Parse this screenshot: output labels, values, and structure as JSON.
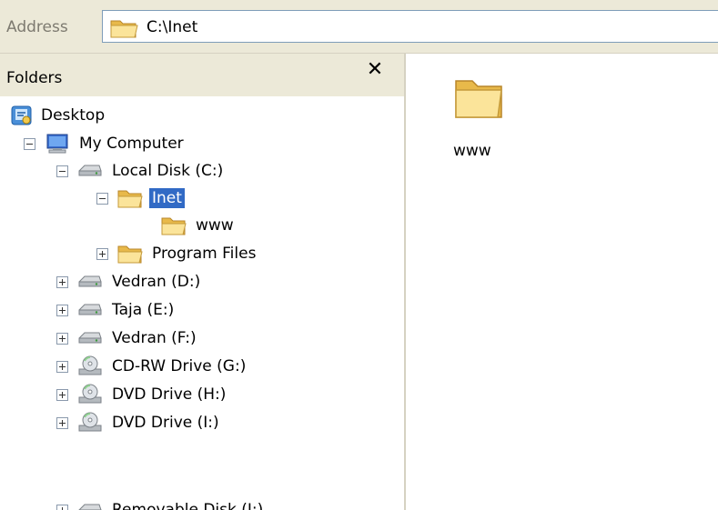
{
  "address": {
    "label": "Address",
    "value": "C:\\Inet"
  },
  "folders_pane": {
    "title": "Folders",
    "close_glyph": "✕",
    "items": [
      {
        "label": "Desktop",
        "icon": "desktop-icon"
      },
      {
        "label": "My Computer",
        "icon": "computer-icon",
        "expander": "minus"
      },
      {
        "label": "Local Disk (C:)",
        "icon": "hard-disk-icon",
        "expander": "minus"
      },
      {
        "label": "Inet",
        "icon": "folder-open-icon",
        "expander": "minus",
        "selected": true
      },
      {
        "label": "www",
        "icon": "folder-icon"
      },
      {
        "label": "Program Files",
        "icon": "folder-icon",
        "expander": "plus"
      },
      {
        "label": "Vedran (D:)",
        "icon": "hard-disk-icon",
        "expander": "plus"
      },
      {
        "label": "Taja (E:)",
        "icon": "hard-disk-icon",
        "expander": "plus"
      },
      {
        "label": "Vedran (F:)",
        "icon": "hard-disk-icon",
        "expander": "plus"
      },
      {
        "label": "CD-RW Drive (G:)",
        "icon": "cd-drive-icon",
        "expander": "plus"
      },
      {
        "label": "DVD Drive (H:)",
        "icon": "cd-drive-icon",
        "expander": "plus"
      },
      {
        "label": "DVD Drive (I:)",
        "icon": "cd-drive-icon",
        "expander": "plus"
      },
      {
        "label": "Removable Disk (J:)",
        "icon": "removable-disk-icon",
        "expander": "plus"
      }
    ]
  },
  "content_pane": {
    "items": [
      {
        "label": "www",
        "icon": "folder-icon"
      }
    ]
  },
  "colors": {
    "selection": "#316ac5",
    "chrome": "#ece9d8",
    "folder_yellow": "#f5d77a"
  }
}
